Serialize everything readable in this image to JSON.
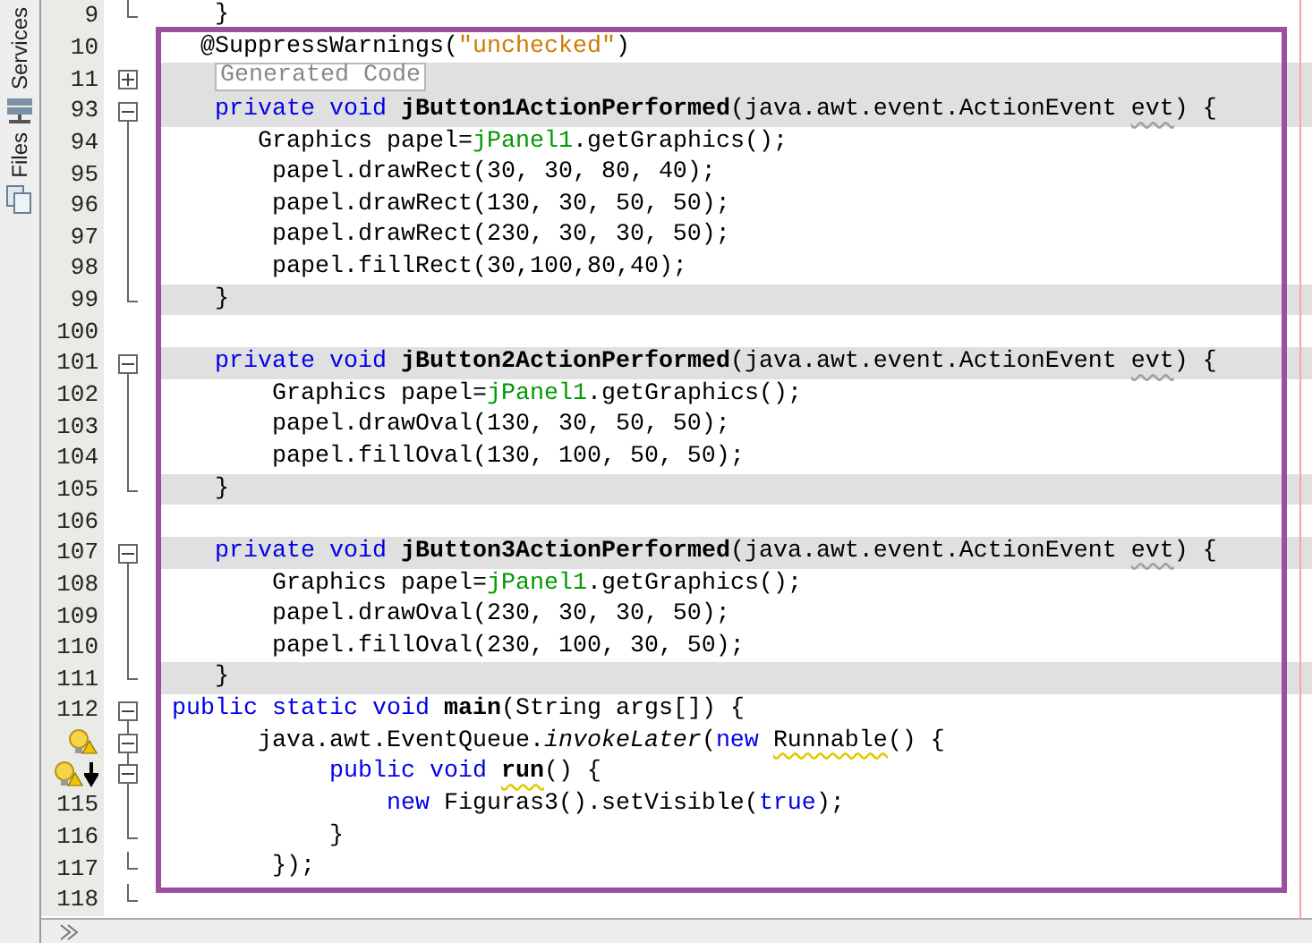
{
  "side_tabs": [
    {
      "label": "Services"
    },
    {
      "label": "Files"
    }
  ],
  "lines": [
    {
      "number": "9",
      "highlighted": false,
      "fold_end": true,
      "segments": [
        {
          "text": "   }",
          "kind": "plain"
        }
      ]
    },
    {
      "number": "10",
      "highlighted": false,
      "segments": [
        {
          "text": "  @SuppressWarnings(",
          "kind": "plain"
        },
        {
          "text": "\"unchecked\"",
          "kind": "string"
        },
        {
          "text": ")",
          "kind": "plain"
        }
      ]
    },
    {
      "number": "11",
      "highlighted": true,
      "expanded": false,
      "segments": [
        {
          "text": "Generated Code",
          "kind": "folded"
        }
      ]
    },
    {
      "number": "93",
      "highlighted": true,
      "expanded": true,
      "segments": [
        {
          "text": "   private void",
          "kind": "keyword"
        },
        {
          "text": " jButton1ActionPerformed",
          "kind": "declaration"
        },
        {
          "text": "(java.awt.event.ActionEvent ",
          "kind": "plain"
        },
        {
          "text": "evt",
          "kind": "plain",
          "hint_underline": true
        },
        {
          "text": ") {",
          "kind": "plain"
        }
      ]
    },
    {
      "number": "94",
      "highlighted": false,
      "fold_guide": true,
      "segments": [
        {
          "text": "      Graphics papel=",
          "kind": "plain"
        },
        {
          "text": "jPanel1",
          "kind": "field"
        },
        {
          "text": ".getGraphics();",
          "kind": "plain"
        }
      ]
    },
    {
      "number": "95",
      "highlighted": false,
      "fold_guide": true,
      "segments": [
        {
          "text": "       papel.drawRect(30, 30, 80, 40);",
          "kind": "plain"
        }
      ]
    },
    {
      "number": "96",
      "highlighted": false,
      "fold_guide": true,
      "segments": [
        {
          "text": "       papel.drawRect(130, 30, 50, 50);",
          "kind": "plain"
        }
      ]
    },
    {
      "number": "97",
      "highlighted": false,
      "fold_guide": true,
      "segments": [
        {
          "text": "       papel.drawRect(230, 30, 30, 50);",
          "kind": "plain"
        }
      ]
    },
    {
      "number": "98",
      "highlighted": false,
      "fold_guide": true,
      "segments": [
        {
          "text": "       papel.fillRect(30,100,80,40);",
          "kind": "plain"
        }
      ]
    },
    {
      "number": "99",
      "highlighted": true,
      "fold_end": true,
      "segments": [
        {
          "text": "   }",
          "kind": "plain"
        }
      ]
    },
    {
      "number": "100",
      "highlighted": false
    },
    {
      "number": "101",
      "highlighted": true,
      "expanded": true,
      "segments": [
        {
          "text": "   private void",
          "kind": "keyword"
        },
        {
          "text": " jButton2ActionPerformed",
          "kind": "declaration"
        },
        {
          "text": "(java.awt.event.ActionEvent ",
          "kind": "plain"
        },
        {
          "text": "evt",
          "kind": "plain",
          "hint_underline": true
        },
        {
          "text": ") {",
          "kind": "plain"
        }
      ]
    },
    {
      "number": "102",
      "highlighted": false,
      "fold_guide": true,
      "segments": [
        {
          "text": "       Graphics papel=",
          "kind": "plain"
        },
        {
          "text": "jPanel1",
          "kind": "field"
        },
        {
          "text": ".getGraphics();",
          "kind": "plain"
        }
      ]
    },
    {
      "number": "103",
      "highlighted": false,
      "fold_guide": true,
      "segments": [
        {
          "text": "       papel.drawOval(130, 30, 50, 50);",
          "kind": "plain"
        }
      ]
    },
    {
      "number": "104",
      "highlighted": false,
      "fold_guide": true,
      "segments": [
        {
          "text": "       papel.fillOval(130, 100, 50, 50);",
          "kind": "plain"
        }
      ]
    },
    {
      "number": "105",
      "highlighted": true,
      "fold_end": true,
      "segments": [
        {
          "text": "   }",
          "kind": "plain"
        }
      ]
    },
    {
      "number": "106",
      "highlighted": false
    },
    {
      "number": "107",
      "highlighted": true,
      "expanded": true,
      "segments": [
        {
          "text": "   private void",
          "kind": "keyword"
        },
        {
          "text": " jButton3ActionPerformed",
          "kind": "declaration"
        },
        {
          "text": "(java.awt.event.ActionEvent ",
          "kind": "plain"
        },
        {
          "text": "evt",
          "kind": "plain",
          "hint_underline": true
        },
        {
          "text": ") {",
          "kind": "plain"
        }
      ]
    },
    {
      "number": "108",
      "highlighted": false,
      "fold_guide": true,
      "segments": [
        {
          "text": "       Graphics papel=",
          "kind": "plain"
        },
        {
          "text": "jPanel1",
          "kind": "field"
        },
        {
          "text": ".getGraphics();",
          "kind": "plain"
        }
      ]
    },
    {
      "number": "109",
      "highlighted": false,
      "fold_guide": true,
      "segments": [
        {
          "text": "       papel.drawOval(230, 30, 30, 50);",
          "kind": "plain"
        }
      ]
    },
    {
      "number": "110",
      "highlighted": false,
      "fold_guide": true,
      "segments": [
        {
          "text": "       papel.fillOval(230, 100, 30, 50);",
          "kind": "plain"
        }
      ]
    },
    {
      "number": "111",
      "highlighted": true,
      "fold_end": true,
      "segments": [
        {
          "text": "   }",
          "kind": "plain"
        }
      ]
    },
    {
      "number": "112",
      "highlighted": false,
      "expanded": true,
      "segments": [
        {
          "text": "public static void",
          "kind": "keyword"
        },
        {
          "text": " main",
          "kind": "declaration"
        },
        {
          "text": "(String args[]) {",
          "kind": "plain"
        }
      ]
    },
    {
      "hint_bulb": true,
      "highlighted": false,
      "expanded": true,
      "segments": [
        {
          "text": "      java.awt.EventQueue.",
          "kind": "plain"
        },
        {
          "text": "invokeLater",
          "kind": "static-call"
        },
        {
          "text": "(",
          "kind": "plain"
        },
        {
          "text": "new ",
          "kind": "keyword"
        },
        {
          "text": "Runnable",
          "kind": "plain",
          "warning_underline": true
        },
        {
          "text": "() {",
          "kind": "plain"
        }
      ]
    },
    {
      "hint_bulb": true,
      "arrow_marker": true,
      "highlighted": false,
      "expanded": true,
      "segments": [
        {
          "text": "           public void ",
          "kind": "keyword"
        },
        {
          "text": "run",
          "kind": "declaration",
          "warning_underline": true
        },
        {
          "text": "() {",
          "kind": "plain"
        }
      ]
    },
    {
      "number": "115",
      "highlighted": false,
      "fold_guide": true,
      "segments": [
        {
          "text": "               new",
          "kind": "keyword"
        },
        {
          "text": " Figuras3().setVisible(",
          "kind": "plain"
        },
        {
          "text": "true",
          "kind": "keyword"
        },
        {
          "text": ");",
          "kind": "plain"
        }
      ]
    },
    {
      "number": "116",
      "highlighted": false,
      "fold_end": true,
      "segments": [
        {
          "text": "           }",
          "kind": "plain"
        }
      ]
    },
    {
      "number": "117",
      "highlighted": false,
      "fold_end": true,
      "segments": [
        {
          "text": "       });",
          "kind": "plain"
        }
      ]
    },
    {
      "number": "118",
      "highlighted": false,
      "fold_end": true
    }
  ]
}
